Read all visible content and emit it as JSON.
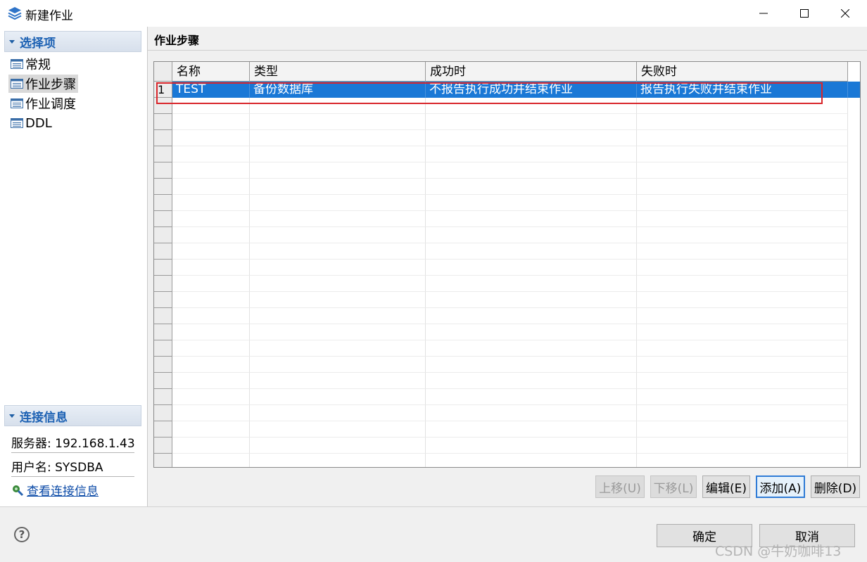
{
  "window": {
    "title": "新建作业"
  },
  "left": {
    "options_header": "选择项",
    "nav": [
      {
        "label": "常规",
        "selected": false
      },
      {
        "label": "作业步骤",
        "selected": true
      },
      {
        "label": "作业调度",
        "selected": false
      },
      {
        "label": "DDL",
        "selected": false
      }
    ],
    "conn_header": "连接信息",
    "server": "服务器: 192.168.1.43",
    "user": "用户名: SYSDBA",
    "view_conn": "查看连接信息"
  },
  "right": {
    "title": "作业步骤",
    "columns": [
      "名称",
      "类型",
      "成功时",
      "失败时"
    ],
    "rows": [
      {
        "num": "1",
        "name": "TEST",
        "type": "备份数据库",
        "success": "不报告执行成功并结束作业",
        "fail": "报告执行失败并结束作业",
        "selected": true
      }
    ],
    "buttons": {
      "up": "上移(U)",
      "down": "下移(L)",
      "edit": "编辑(E)",
      "add": "添加(A)",
      "delete": "删除(D)"
    }
  },
  "footer": {
    "ok": "确定",
    "cancel": "取消",
    "help_icon": "help-icon",
    "watermark": "CSDN @牛奶咖啡13"
  },
  "colors": {
    "accent": "#1a78d6",
    "header_text": "#1c61b3",
    "highlight_box": "#d9262b"
  }
}
